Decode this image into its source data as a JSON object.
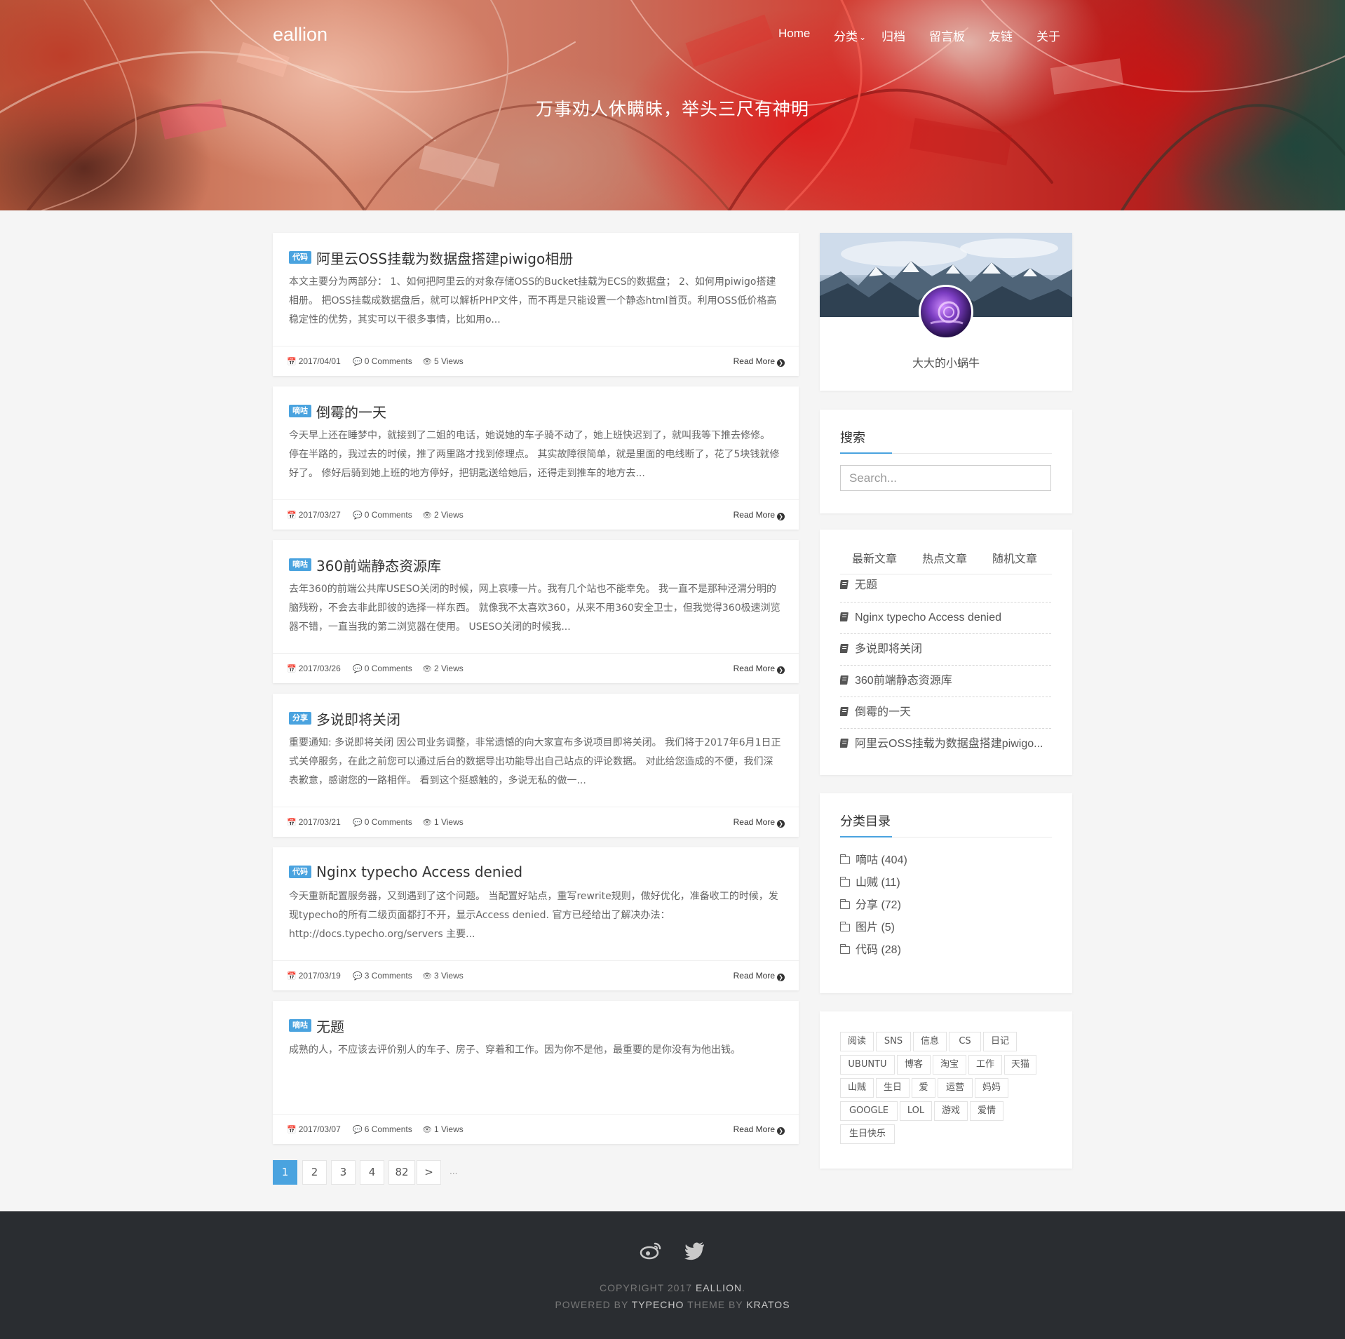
{
  "site": {
    "brand": "eallion",
    "slogan": "万事劝人休瞒昧，举头三尺有神明"
  },
  "nav": [
    {
      "label": "Home"
    },
    {
      "label": "分类",
      "has_dropdown": true
    },
    {
      "label": "归档"
    },
    {
      "label": "留言板"
    },
    {
      "label": "友链"
    },
    {
      "label": "关于"
    }
  ],
  "posts": [
    {
      "badge": "代码",
      "title": "阿里云OSS挂载为数据盘搭建piwigo相册",
      "excerpt": "本文主要分为两部分： 1、如何把阿里云的对象存储OSS的Bucket挂载为ECS的数据盘； 2、如何用piwigo搭建相册。 把OSS挂载成数据盘后，就可以解析PHP文件，而不再是只能设置一个静态html首页。利用OSS低价格高稳定性的优势，其实可以干很多事情，比如用o...",
      "date": "2017/04/01",
      "comments": "0 Comments",
      "views": "5 Views",
      "read_more": "Read More"
    },
    {
      "badge": "嘀咕",
      "title": "倒霉的一天",
      "excerpt": "今天早上还在睡梦中，就接到了二姐的电话，她说她的车子骑不动了，她上班快迟到了，就叫我等下推去修修。 停在半路的，我过去的时候，推了两里路才找到修理点。 其实故障很简单，就是里面的电线断了，花了5块钱就修好了。 修好后骑到她上班的地方停好，把钥匙送给她后，还得走到推车的地方去...",
      "date": "2017/03/27",
      "comments": "0 Comments",
      "views": "2 Views",
      "read_more": "Read More"
    },
    {
      "badge": "嘀咕",
      "title": "360前端静态资源库",
      "excerpt": "去年360的前端公共库USESO关闭的时候，网上哀嚎一片。我有几个站也不能幸免。 我一直不是那种泾渭分明的脑残粉，不会去非此即彼的选择一样东西。 就像我不太喜欢360，从来不用360安全卫士，但我觉得360极速浏览器不错，一直当我的第二浏览器在使用。 USESO关闭的时候我...",
      "date": "2017/03/26",
      "comments": "0 Comments",
      "views": "2 Views",
      "read_more": "Read More"
    },
    {
      "badge": "分享",
      "title": "多说即将关闭",
      "excerpt": "重要通知: 多说即将关闭 因公司业务调整，非常遗憾的向大家宣布多说项目即将关闭。 我们将于2017年6月1日正式关停服务，在此之前您可以通过后台的数据导出功能导出自己站点的评论数据。 对此给您造成的不便，我们深表歉意，感谢您的一路相伴。 看到这个挺感触的，多说无私的做一...",
      "date": "2017/03/21",
      "comments": "0 Comments",
      "views": "1 Views",
      "read_more": "Read More"
    },
    {
      "badge": "代码",
      "title": "Nginx typecho Access denied",
      "excerpt": "今天重新配置服务器，又到遇到了这个问题。 当配置好站点，重写rewrite规则，做好优化，准备收工的时候，发现typecho的所有二级页面都打不开，显示Access denied. 官方已经给出了解决办法：http://docs.typecho.org/servers 主要...",
      "date": "2017/03/19",
      "comments": "3 Comments",
      "views": "3 Views",
      "read_more": "Read More"
    },
    {
      "badge": "嘀咕",
      "title": "无题",
      "excerpt": "成熟的人，不应该去评价别人的车子、房子、穿着和工作。因为你不是他，最重要的是你没有为他出钱。",
      "date": "2017/03/07",
      "comments": "6 Comments",
      "views": "1 Views",
      "read_more": "Read More"
    }
  ],
  "pagination": {
    "pages": [
      "1",
      "2",
      "3",
      "4",
      "82"
    ],
    "current": "1",
    "next": ">",
    "ellipsis": "..."
  },
  "profile": {
    "name": "大大的小蜗牛"
  },
  "search": {
    "title": "搜索",
    "placeholder": "Search..."
  },
  "posts_widget": {
    "tabs": [
      "最新文章",
      "热点文章",
      "随机文章"
    ],
    "items": [
      "无题",
      "Nginx typecho Access denied",
      "多说即将关闭",
      "360前端静态资源库",
      "倒霉的一天",
      "阿里云OSS挂载为数据盘搭建piwigo..."
    ]
  },
  "categories": {
    "title": "分类目录",
    "items": [
      {
        "label": "嘀咕 (404)"
      },
      {
        "label": "山贼 (11)"
      },
      {
        "label": "分享 (72)"
      },
      {
        "label": "图片 (5)"
      },
      {
        "label": "代码 (28)"
      }
    ]
  },
  "tags": [
    "阅读",
    "SNS",
    "信息",
    "CS",
    "日记",
    "UBUNTU",
    "博客",
    "淘宝",
    "工作",
    "天猫",
    "山贼",
    "生日",
    "爱",
    "运营",
    "妈妈",
    "GOOGLE",
    "LOL",
    "游戏",
    "爱情",
    "生日快乐"
  ],
  "footer": {
    "social": [
      "weibo-icon",
      "twitter-icon"
    ],
    "copyright_prefix": "COPYRIGHT 2017",
    "copyright_name": "EALLION",
    "copyright_suffix": ".",
    "powered_prefix": "POWERED BY",
    "powered_name": "TYPECHO",
    "theme_prefix": "THEME BY",
    "theme_name": "KRATOS"
  },
  "colors": {
    "accent": "#4aa3df",
    "footer_bg": "#2a2d31",
    "page_bg": "#f5f5f5"
  }
}
